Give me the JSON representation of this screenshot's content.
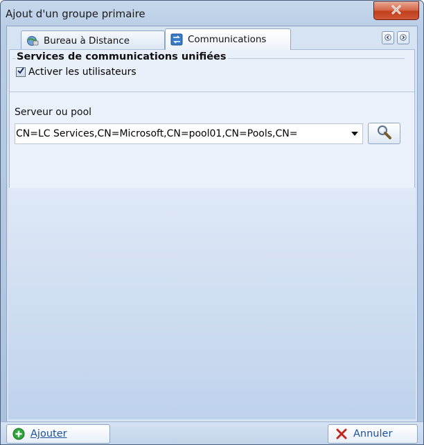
{
  "window": {
    "title": "Ajout d'un groupe primaire",
    "close_icon": "close-icon"
  },
  "tabs": [
    {
      "label": "Bureau à Distance",
      "icon": "remote-desktop-icon",
      "active": false
    },
    {
      "label": "Communications",
      "icon": "communications-icon",
      "active": true
    }
  ],
  "tab_nav": {
    "prev_icon": "chevron-left-icon",
    "next_icon": "chevron-right-icon"
  },
  "group": {
    "title": "Services de communications unifiées",
    "checkbox_label": "Activer les utilisateurs",
    "checkbox_checked": true
  },
  "server": {
    "label": "Serveur ou pool",
    "value": "CN=LC Services,CN=Microsoft,CN=pool01,CN=Pools,CN=",
    "search_icon": "magnifier-icon"
  },
  "footer": {
    "add_label": "Ajouter",
    "add_icon": "plus-icon",
    "cancel_label": "Annuler",
    "cancel_icon": "x-icon"
  },
  "colors": {
    "title_close": "#c0401c",
    "accent": "#1c4f9c",
    "cancel_x": "#c3261b",
    "add_green": "#2fa83a"
  }
}
